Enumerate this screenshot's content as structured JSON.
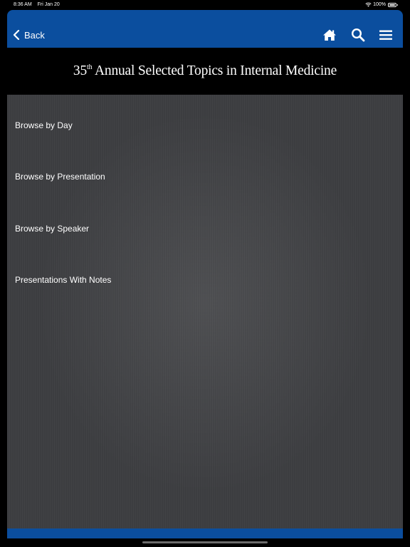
{
  "status_bar": {
    "time": "8:36 AM",
    "date": "Fri Jan 20",
    "battery": "100%"
  },
  "nav": {
    "back_label": "Back",
    "icons": [
      "chevron-left-icon",
      "home-icon",
      "search-icon",
      "menu-icon"
    ]
  },
  "title": {
    "number": "35",
    "suffix": "th",
    "text": " Annual Selected Topics in Internal Medicine"
  },
  "menu": {
    "items": [
      {
        "label": "Browse by Day"
      },
      {
        "label": "Browse by Presentation"
      },
      {
        "label": "Browse by Speaker"
      },
      {
        "label": "Presentations With Notes"
      }
    ]
  },
  "colors": {
    "brand_blue": "#0b4e9e",
    "content_bg": "#3c3d40",
    "title_bg": "#000000",
    "text": "#ffffff"
  }
}
